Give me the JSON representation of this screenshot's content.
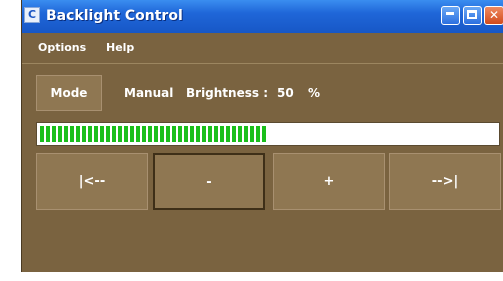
{
  "window": {
    "title": "Backlight Control",
    "app_icon": "monitor-icon",
    "controls": [
      "minimize-icon",
      "maximize-icon",
      "close-icon"
    ]
  },
  "menu": {
    "options": "Options",
    "help": "Help"
  },
  "mode_button": {
    "label": "Mode"
  },
  "status": {
    "mode": "Manual",
    "brightness_label": "Brightness :",
    "brightness_value": "50",
    "unit": "%"
  },
  "brightness_bar": {
    "fill_fraction": 0.5,
    "color": "#1bbf1b"
  },
  "controls": {
    "first": "|<--",
    "minus": "-",
    "plus": "+",
    "last": "-->|"
  },
  "colors": {
    "window_bg": "#7a6340",
    "button_bg": "#8f7752",
    "title_bar": "#1f66d8"
  }
}
